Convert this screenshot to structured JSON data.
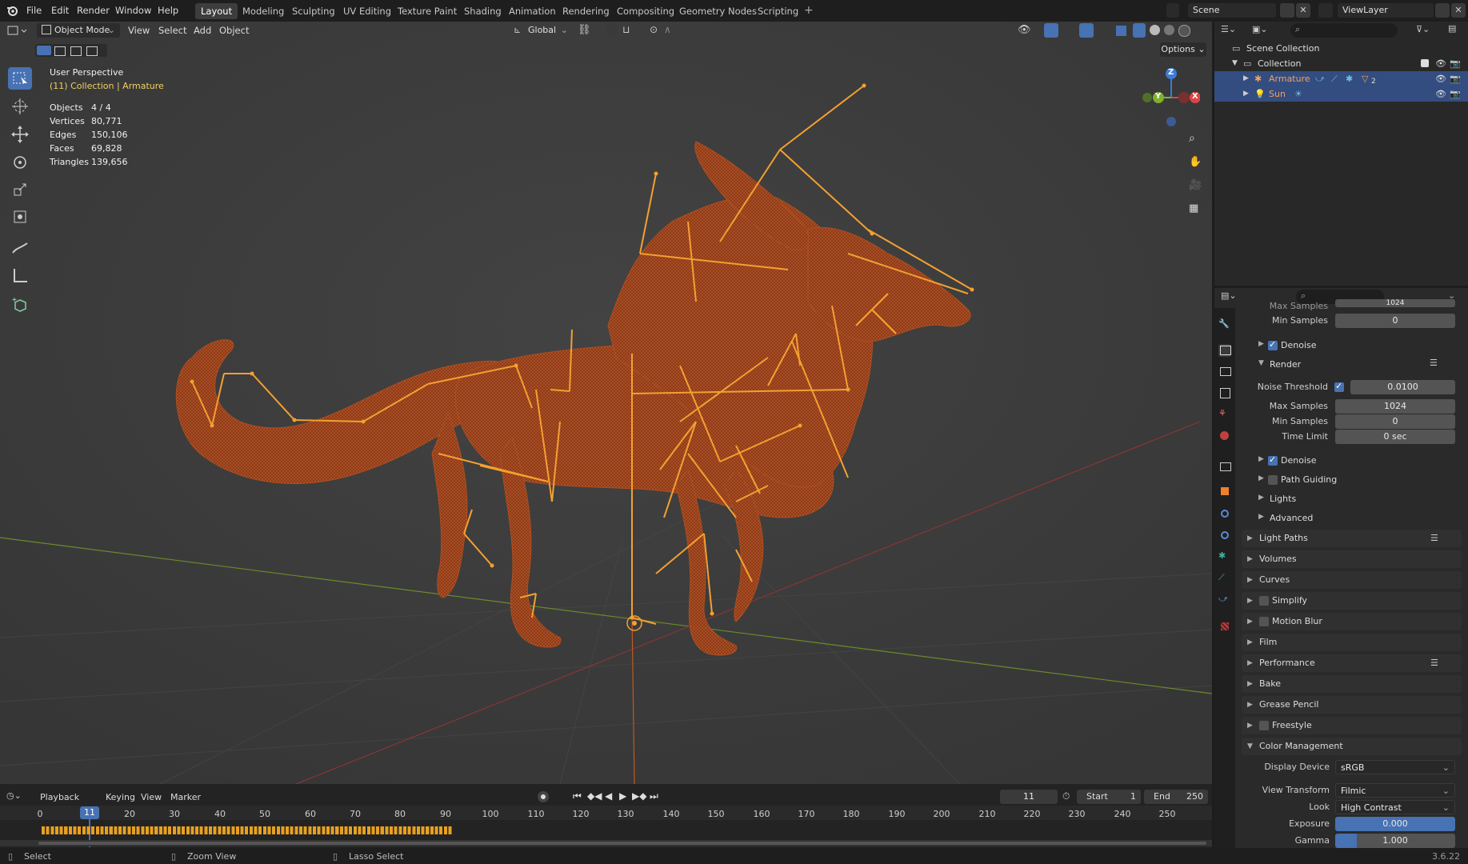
{
  "topbar": {
    "menus": [
      "File",
      "Edit",
      "Render",
      "Window",
      "Help"
    ],
    "workspaces": [
      "Layout",
      "Modeling",
      "Sculpting",
      "UV Editing",
      "Texture Paint",
      "Shading",
      "Animation",
      "Rendering",
      "Compositing",
      "Geometry Nodes",
      "Scripting"
    ],
    "active_workspace": "Layout",
    "scene": "Scene",
    "view_layer": "ViewLayer"
  },
  "viewport_header": {
    "mode": "Object Mode",
    "menus": [
      "View",
      "Select",
      "Add",
      "Object"
    ],
    "transform_orientation": "Global",
    "options_label": "Options"
  },
  "overlay": {
    "view_name": "User Perspective",
    "context": "(11) Collection | Armature",
    "stats": [
      {
        "label": "Objects",
        "value": "4 / 4"
      },
      {
        "label": "Vertices",
        "value": "80,771"
      },
      {
        "label": "Edges",
        "value": "150,106"
      },
      {
        "label": "Faces",
        "value": "69,828"
      },
      {
        "label": "Triangles",
        "value": "139,656"
      }
    ]
  },
  "gizmo": {
    "z": "Z",
    "y": "Y",
    "x": "X"
  },
  "outliner": {
    "root": "Scene Collection",
    "collection": "Collection",
    "items": [
      {
        "name": "Armature",
        "badge": "2",
        "color": "#f0a060"
      },
      {
        "name": "Sun",
        "color": "#f0a060"
      }
    ]
  },
  "properties": {
    "top_partial": "Max Samples",
    "top_partial_value": "1024",
    "viewport_min_samples_label": "Min Samples",
    "viewport_min_samples": "0",
    "denoise_label": "Denoise",
    "render_panel": "Render",
    "noise_threshold_label": "Noise Threshold",
    "noise_threshold": "0.0100",
    "max_samples_label": "Max Samples",
    "max_samples": "1024",
    "min_samples_label": "Min Samples",
    "min_samples": "0",
    "time_limit_label": "Time Limit",
    "time_limit": "0 sec",
    "render_denoise_label": "Denoise",
    "path_guiding_label": "Path Guiding",
    "lights_label": "Lights",
    "advanced_label": "Advanced",
    "panels": [
      "Light Paths",
      "Volumes",
      "Curves",
      "Simplify",
      "Motion Blur",
      "Film",
      "Performance",
      "Bake",
      "Grease Pencil",
      "Freestyle"
    ],
    "color_management": {
      "title": "Color Management",
      "display_device_label": "Display Device",
      "display_device": "sRGB",
      "view_transform_label": "View Transform",
      "view_transform": "Filmic",
      "look_label": "Look",
      "look": "High Contrast",
      "exposure_label": "Exposure",
      "exposure": "0.000",
      "gamma_label": "Gamma",
      "gamma": "1.000"
    }
  },
  "timeline": {
    "menus": [
      "Playback",
      "Keying",
      "View",
      "Marker"
    ],
    "current_frame": "11",
    "start_label": "Start",
    "start": "1",
    "end_label": "End",
    "end": "250",
    "ruler": [
      "0",
      "20",
      "30",
      "40",
      "50",
      "60",
      "70",
      "80",
      "90",
      "100",
      "110",
      "120",
      "130",
      "140",
      "150",
      "160",
      "170",
      "180",
      "190",
      "200",
      "210",
      "220",
      "230",
      "240",
      "250"
    ]
  },
  "statusbar": {
    "select": "Select",
    "zoom": "Zoom View",
    "lasso": "Lasso Select",
    "version": "3.6.22"
  },
  "colors": {
    "accent": "#4772b3",
    "armature_orange": "#f5a030",
    "mesh_orange": "#c0501e",
    "context_yellow": "#f0d060"
  }
}
